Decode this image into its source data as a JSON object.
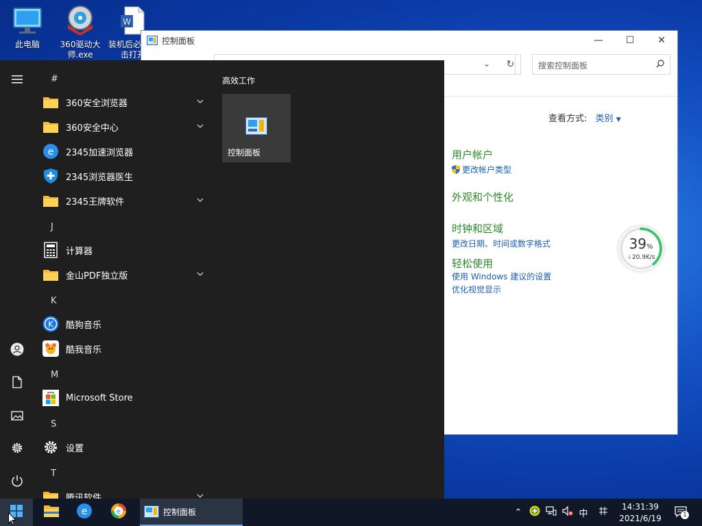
{
  "desktop": {
    "icons": [
      {
        "label": "此电脑",
        "icon": "computer-icon"
      },
      {
        "label": "360驱动大师.exe",
        "icon": "driver-master-icon"
      },
      {
        "label": "装机后必看双击打开",
        "icon": "word-doc-icon"
      }
    ]
  },
  "control_panel": {
    "title": "控制面板",
    "search_placeholder": "搜索控制面板",
    "view_label": "查看方式:",
    "view_value": "类别",
    "categories": [
      {
        "title": "用户帐户",
        "links": [
          "更改帐户类型"
        ]
      },
      {
        "title": "外观和个性化",
        "links": []
      },
      {
        "title": "时钟和区域",
        "links": [
          "更改日期、时间或数字格式"
        ]
      },
      {
        "title": "轻松使用",
        "links": [
          "使用 Windows 建议的设置",
          "优化视觉显示"
        ]
      }
    ]
  },
  "speed_widget": {
    "percent": "39",
    "percent_unit": "%",
    "rate": "20.9K/s",
    "percent_value": 39
  },
  "start_menu": {
    "sections": [
      {
        "letter": "#",
        "apps": [
          {
            "name": "360安全浏览器",
            "icon": "folder-icon",
            "expandable": true
          },
          {
            "name": "360安全中心",
            "icon": "folder-icon",
            "expandable": true
          },
          {
            "name": "2345加速浏览器",
            "icon": "ie-browser-icon",
            "expandable": false
          },
          {
            "name": "2345浏览器医生",
            "icon": "shield-plus-icon",
            "expandable": false
          },
          {
            "name": "2345王牌软件",
            "icon": "folder-icon",
            "expandable": true
          }
        ]
      },
      {
        "letter": "J",
        "apps": [
          {
            "name": "计算器",
            "icon": "calculator-icon",
            "expandable": false
          },
          {
            "name": "金山PDF独立版",
            "icon": "folder-icon",
            "expandable": true
          }
        ]
      },
      {
        "letter": "K",
        "apps": [
          {
            "name": "酷狗音乐",
            "icon": "kugou-icon",
            "expandable": false
          },
          {
            "name": "酷我音乐",
            "icon": "kuwo-icon",
            "expandable": false
          }
        ]
      },
      {
        "letter": "M",
        "apps": [
          {
            "name": "Microsoft Store",
            "icon": "store-icon",
            "expandable": false
          }
        ]
      },
      {
        "letter": "S",
        "apps": [
          {
            "name": "设置",
            "icon": "gear-icon",
            "expandable": false
          }
        ]
      },
      {
        "letter": "T",
        "apps": [
          {
            "name": "腾讯软件",
            "icon": "folder-icon",
            "expandable": true
          }
        ]
      }
    ],
    "tiles_group": "高效工作",
    "tile_label": "控制面板"
  },
  "taskbar": {
    "active_window": "控制面板",
    "ime": "中",
    "time": "14:31:39",
    "date": "2021/6/19",
    "notification_count": "1"
  }
}
